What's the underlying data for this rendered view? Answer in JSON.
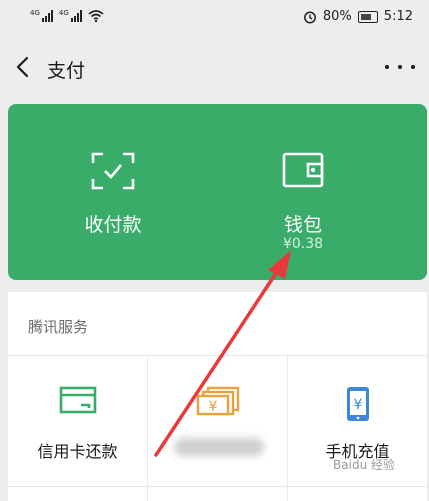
{
  "status_bar": {
    "network_1": "4G",
    "network_2": "4G",
    "battery_percent": "80%",
    "time": "5:12"
  },
  "nav": {
    "title": "支付"
  },
  "wallet_card": {
    "color": "#3aac6a",
    "collect_pay_label": "收付款",
    "wallet_label": "钱包",
    "wallet_balance": "¥0.38"
  },
  "services": {
    "section_title": "腾讯服务",
    "items": [
      {
        "label": "信用卡还款",
        "icon": "credit-card-icon",
        "color": "#3aac6a"
      },
      {
        "label": "",
        "icon": "money-icon",
        "color": "#e8a23a"
      },
      {
        "label": "手机充值",
        "icon": "phone-recharge-icon",
        "color": "#3b87d8"
      }
    ]
  },
  "annotation": {
    "arrow_color": "#e83a3a"
  },
  "watermark": "Baidu 经验"
}
